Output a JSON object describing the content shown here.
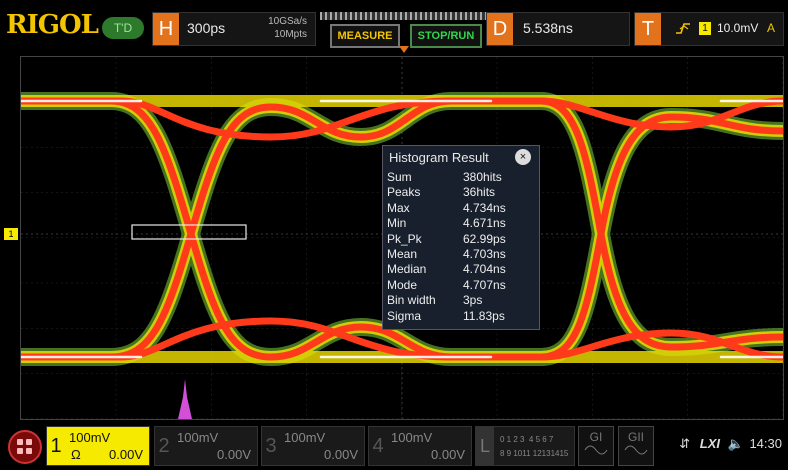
{
  "brand": "RIGOL",
  "trigger_status": "T'D",
  "horizontal": {
    "key": "H",
    "timebase": "300ps",
    "sample_rate": "10GSa/s",
    "memory_depth": "10Mpts"
  },
  "buttons": {
    "measure": "MEASURE",
    "stop_run": "STOP/RUN"
  },
  "delay": {
    "key": "D",
    "value": "5.538ns"
  },
  "trigger": {
    "key": "T",
    "channel": "1",
    "level": "10.0mV",
    "mode": "A"
  },
  "markers": {
    "trigger_marker": "T",
    "channel_marker": "1"
  },
  "histogram": {
    "title": "Histogram Result",
    "close_icon": "×",
    "rows": [
      {
        "label": "Sum",
        "value": "380hits"
      },
      {
        "label": "Peaks",
        "value": "36hits"
      },
      {
        "label": "Max",
        "value": "4.734ns"
      },
      {
        "label": "Min",
        "value": "4.671ns"
      },
      {
        "label": "Pk_Pk",
        "value": "62.99ps"
      },
      {
        "label": "Mean",
        "value": "4.703ns"
      },
      {
        "label": "Median",
        "value": "4.704ns"
      },
      {
        "label": "Mode",
        "value": "4.707ns"
      },
      {
        "label": "Bin width",
        "value": "3ps"
      },
      {
        "label": "Sigma",
        "value": "11.83ps"
      }
    ]
  },
  "channels": [
    {
      "num": "1",
      "scale": "100mV",
      "unit": "Ω",
      "offset": "0.00V",
      "active": true
    },
    {
      "num": "2",
      "scale": "100mV",
      "offset": "0.00V",
      "active": false
    },
    {
      "num": "3",
      "scale": "100mV",
      "offset": "0.00V",
      "active": false
    },
    {
      "num": "4",
      "scale": "100mV",
      "offset": "0.00V",
      "active": false
    }
  ],
  "logic": {
    "key": "L",
    "row1": "0 1 2 3  4 5 6 7",
    "row2": "8 9 1011 12131415"
  },
  "generators": [
    "GI",
    "GII"
  ],
  "status": {
    "lxi": "LXI",
    "time": "14:30"
  },
  "colors": {
    "accent": "#e2731c",
    "ch1": "#f5ea00",
    "eye": "#ff3a1a",
    "histogram": "#d24fd6"
  }
}
